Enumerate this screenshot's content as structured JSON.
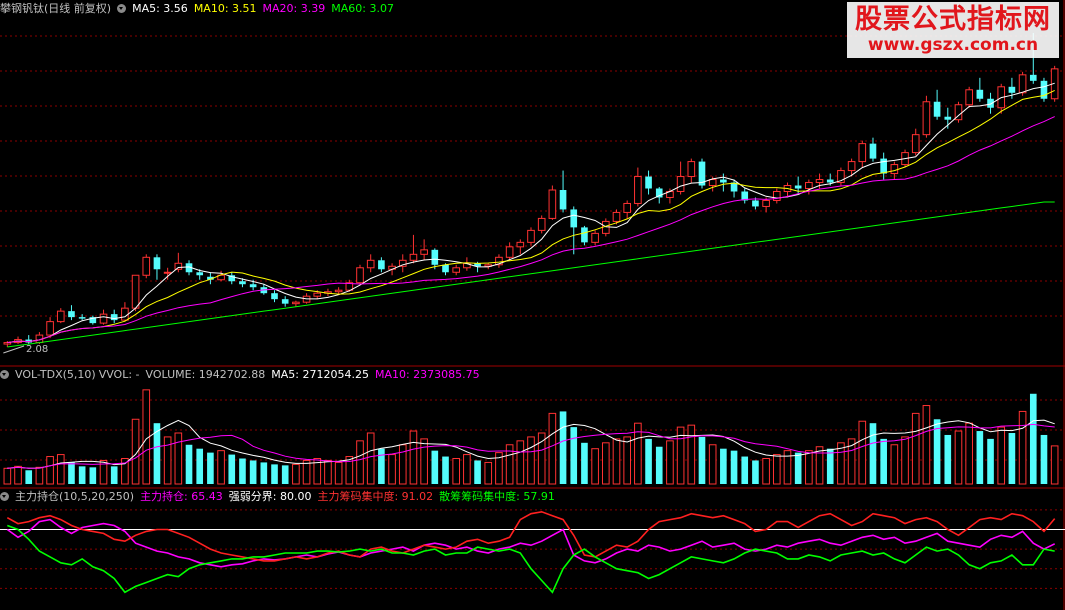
{
  "header_price": {
    "stock_name": "攀钢钒钛(日线 前复权)",
    "ma5": "MA5: 3.56",
    "ma10": "MA10: 3.51",
    "ma20": "MA20: 3.39",
    "ma60": "MA60: 3.07"
  },
  "header_volume": {
    "indicator": "VOL-TDX(5,10)",
    "vvol": "VVOL: -",
    "volume": "VOLUME: 1942702.88",
    "ma5": "MA5: 2712054.25",
    "ma10": "MA10: 2373085.75"
  },
  "header_zl": {
    "indicator": "主力持仓(10,5,20,250)",
    "holding": "主力持仓: 65.43",
    "boundary": "强弱分界: 80.00",
    "main_conc": "主力筹码集中度: 91.02",
    "retail_conc": "散筹筹码集中度: 57.91"
  },
  "low_label": "2.08",
  "watermark": {
    "title": "股票公式指标网",
    "url": "www.gszx.com.cn"
  },
  "colors": {
    "up": "#ff3232",
    "down": "#54fcfc",
    "ma5": "#ffffff",
    "ma10": "#ffff00",
    "ma20": "#ff00ff",
    "ma60": "#00ff00",
    "grid": "#8b0000",
    "frame": "#a00000"
  },
  "chart_data": [
    {
      "type": "candlestick",
      "title": "攀钢钒钛(日线 前复权)",
      "ylim": [
        2.0,
        4.3
      ],
      "low_marker": 2.08,
      "ohlc": [
        [
          2.12,
          2.14,
          2.1,
          2.13
        ],
        [
          2.13,
          2.17,
          2.12,
          2.15
        ],
        [
          2.15,
          2.18,
          2.12,
          2.13
        ],
        [
          2.13,
          2.2,
          2.12,
          2.18
        ],
        [
          2.18,
          2.3,
          2.16,
          2.27
        ],
        [
          2.27,
          2.36,
          2.26,
          2.34
        ],
        [
          2.34,
          2.38,
          2.28,
          2.3
        ],
        [
          2.3,
          2.32,
          2.28,
          2.29
        ],
        [
          2.3,
          2.31,
          2.25,
          2.26
        ],
        [
          2.26,
          2.35,
          2.25,
          2.32
        ],
        [
          2.32,
          2.35,
          2.26,
          2.28
        ],
        [
          2.28,
          2.4,
          2.27,
          2.36
        ],
        [
          2.36,
          2.58,
          2.34,
          2.58
        ],
        [
          2.58,
          2.72,
          2.56,
          2.7
        ],
        [
          2.7,
          2.72,
          2.55,
          2.62
        ],
        [
          2.6,
          2.63,
          2.55,
          2.6
        ],
        [
          2.62,
          2.73,
          2.6,
          2.66
        ],
        [
          2.66,
          2.68,
          2.58,
          2.6
        ],
        [
          2.6,
          2.62,
          2.55,
          2.58
        ],
        [
          2.57,
          2.6,
          2.52,
          2.55
        ],
        [
          2.55,
          2.61,
          2.54,
          2.58
        ],
        [
          2.58,
          2.6,
          2.52,
          2.54
        ],
        [
          2.54,
          2.56,
          2.5,
          2.52
        ],
        [
          2.52,
          2.55,
          2.48,
          2.5
        ],
        [
          2.5,
          2.52,
          2.45,
          2.46
        ],
        [
          2.46,
          2.48,
          2.4,
          2.42
        ],
        [
          2.42,
          2.44,
          2.37,
          2.39
        ],
        [
          2.39,
          2.41,
          2.37,
          2.4
        ],
        [
          2.4,
          2.46,
          2.39,
          2.44
        ],
        [
          2.44,
          2.48,
          2.42,
          2.46
        ],
        [
          2.46,
          2.49,
          2.44,
          2.47
        ],
        [
          2.47,
          2.5,
          2.45,
          2.48
        ],
        [
          2.48,
          2.55,
          2.47,
          2.53
        ],
        [
          2.53,
          2.65,
          2.52,
          2.63
        ],
        [
          2.63,
          2.72,
          2.6,
          2.68
        ],
        [
          2.68,
          2.7,
          2.6,
          2.62
        ],
        [
          2.62,
          2.66,
          2.58,
          2.64
        ],
        [
          2.64,
          2.72,
          2.6,
          2.68
        ],
        [
          2.68,
          2.85,
          2.66,
          2.72
        ],
        [
          2.72,
          2.82,
          2.68,
          2.75
        ],
        [
          2.75,
          2.76,
          2.62,
          2.65
        ],
        [
          2.65,
          2.66,
          2.58,
          2.6
        ],
        [
          2.6,
          2.65,
          2.58,
          2.63
        ],
        [
          2.63,
          2.7,
          2.61,
          2.66
        ],
        [
          2.66,
          2.67,
          2.6,
          2.64
        ],
        [
          2.64,
          2.66,
          2.62,
          2.65
        ],
        [
          2.65,
          2.72,
          2.63,
          2.7
        ],
        [
          2.7,
          2.8,
          2.68,
          2.77
        ],
        [
          2.77,
          2.82,
          2.72,
          2.8
        ],
        [
          2.8,
          2.9,
          2.78,
          2.88
        ],
        [
          2.88,
          2.98,
          2.86,
          2.96
        ],
        [
          2.96,
          3.18,
          2.95,
          3.15
        ],
        [
          3.15,
          3.28,
          3.0,
          3.02
        ],
        [
          3.02,
          3.04,
          2.72,
          2.9
        ],
        [
          2.9,
          2.91,
          2.78,
          2.8
        ],
        [
          2.8,
          2.88,
          2.78,
          2.86
        ],
        [
          2.86,
          2.96,
          2.84,
          2.94
        ],
        [
          2.94,
          3.02,
          2.92,
          3.0
        ],
        [
          3.0,
          3.08,
          2.96,
          3.06
        ],
        [
          3.06,
          3.3,
          3.04,
          3.24
        ],
        [
          3.24,
          3.28,
          3.12,
          3.16
        ],
        [
          3.16,
          3.17,
          3.06,
          3.1
        ],
        [
          3.1,
          3.16,
          3.06,
          3.14
        ],
        [
          3.14,
          3.34,
          3.12,
          3.24
        ],
        [
          3.24,
          3.36,
          3.2,
          3.34
        ],
        [
          3.34,
          3.36,
          3.16,
          3.18
        ],
        [
          3.18,
          3.24,
          3.14,
          3.22
        ],
        [
          3.22,
          3.26,
          3.14,
          3.2
        ],
        [
          3.2,
          3.22,
          3.1,
          3.14
        ],
        [
          3.14,
          3.16,
          3.06,
          3.08
        ],
        [
          3.08,
          3.1,
          3.02,
          3.04
        ],
        [
          3.04,
          3.1,
          3.0,
          3.08
        ],
        [
          3.08,
          3.16,
          3.06,
          3.14
        ],
        [
          3.14,
          3.2,
          3.1,
          3.18
        ],
        [
          3.18,
          3.24,
          3.12,
          3.16
        ],
        [
          3.16,
          3.22,
          3.12,
          3.2
        ],
        [
          3.2,
          3.26,
          3.16,
          3.22
        ],
        [
          3.22,
          3.26,
          3.18,
          3.2
        ],
        [
          3.2,
          3.3,
          3.18,
          3.28
        ],
        [
          3.28,
          3.36,
          3.24,
          3.34
        ],
        [
          3.34,
          3.48,
          3.3,
          3.46
        ],
        [
          3.46,
          3.5,
          3.34,
          3.36
        ],
        [
          3.36,
          3.4,
          3.22,
          3.26
        ],
        [
          3.26,
          3.34,
          3.22,
          3.32
        ],
        [
          3.32,
          3.42,
          3.3,
          3.4
        ],
        [
          3.4,
          3.56,
          3.38,
          3.52
        ],
        [
          3.52,
          3.78,
          3.5,
          3.74
        ],
        [
          3.74,
          3.82,
          3.62,
          3.64
        ],
        [
          3.64,
          3.7,
          3.56,
          3.62
        ],
        [
          3.62,
          3.74,
          3.6,
          3.72
        ],
        [
          3.72,
          3.84,
          3.7,
          3.82
        ],
        [
          3.82,
          3.9,
          3.74,
          3.76
        ],
        [
          3.76,
          3.8,
          3.66,
          3.7
        ],
        [
          3.7,
          3.86,
          3.66,
          3.84
        ],
        [
          3.84,
          3.9,
          3.76,
          3.8
        ],
        [
          3.8,
          3.94,
          3.78,
          3.92
        ],
        [
          3.92,
          4.2,
          3.86,
          3.88
        ],
        [
          3.88,
          3.9,
          3.74,
          3.76
        ],
        [
          3.76,
          3.98,
          3.74,
          3.96
        ]
      ],
      "ma60": [
        2.1,
        2.11,
        2.12,
        2.13,
        2.14,
        2.15,
        2.16,
        2.17,
        2.18,
        2.19,
        2.2,
        2.21,
        2.22,
        2.23,
        2.24,
        2.25,
        2.26,
        2.27,
        2.28,
        2.29,
        2.3,
        2.31,
        2.32,
        2.33,
        2.34,
        2.35,
        2.36,
        2.37,
        2.38,
        2.39,
        2.4,
        2.41,
        2.42,
        2.43,
        2.44,
        2.45,
        2.46,
        2.47,
        2.48,
        2.49,
        2.5,
        2.51,
        2.52,
        2.53,
        2.54,
        2.55,
        2.56,
        2.57,
        2.58,
        2.59,
        2.6,
        2.61,
        2.62,
        2.63,
        2.64,
        2.65,
        2.66,
        2.67,
        2.68,
        2.69,
        2.7,
        2.71,
        2.72,
        2.73,
        2.74,
        2.75,
        2.76,
        2.77,
        2.78,
        2.79,
        2.8,
        2.81,
        2.82,
        2.83,
        2.84,
        2.85,
        2.86,
        2.87,
        2.88,
        2.89,
        2.9,
        2.91,
        2.92,
        2.93,
        2.94,
        2.95,
        2.96,
        2.97,
        2.98,
        2.99,
        3.0,
        3.01,
        3.02,
        3.03,
        3.04,
        3.05,
        3.06,
        3.07,
        3.07
      ]
    },
    {
      "type": "bar",
      "title": "VOL-TDX(5,10)",
      "ylim": [
        0,
        5200000
      ],
      "volume": [
        800000,
        900000,
        700000,
        850000,
        1400000,
        1500000,
        1100000,
        900000,
        850000,
        1200000,
        900000,
        1300000,
        3300000,
        4800000,
        3100000,
        2400000,
        2600000,
        2000000,
        1800000,
        1600000,
        1700000,
        1500000,
        1300000,
        1200000,
        1100000,
        1000000,
        950000,
        1000000,
        1200000,
        1300000,
        1200000,
        1100000,
        1400000,
        2200000,
        2600000,
        1800000,
        1500000,
        2000000,
        2700000,
        2300000,
        1700000,
        1400000,
        1300000,
        1500000,
        1200000,
        1100000,
        1600000,
        2000000,
        2200000,
        2400000,
        2600000,
        3600000,
        3700000,
        2900000,
        2100000,
        1800000,
        2100000,
        2300000,
        2400000,
        3100000,
        2300000,
        1900000,
        2200000,
        2900000,
        3000000,
        2400000,
        2000000,
        1800000,
        1700000,
        1400000,
        1200000,
        1300000,
        1500000,
        1700000,
        1600000,
        1700000,
        1900000,
        1800000,
        2100000,
        2300000,
        3200000,
        3100000,
        2300000,
        2000000,
        2400000,
        3600000,
        4000000,
        3300000,
        2500000,
        2700000,
        3100000,
        2700000,
        2300000,
        2900000,
        2600000,
        3700000,
        4600000,
        2500000,
        1942702.88
      ],
      "ma5_last": 2712054.25,
      "ma10_last": 2373085.75
    },
    {
      "type": "line",
      "title": "主力持仓(10,5,20,250)",
      "ylim": [
        0,
        110
      ],
      "boundary": 80,
      "series": [
        {
          "name": "主力持仓",
          "values": [
            80,
            72,
            78,
            88,
            90,
            82,
            76,
            82,
            84,
            86,
            84,
            78,
            66,
            62,
            58,
            56,
            52,
            50,
            46,
            44,
            42,
            44,
            45,
            48,
            50,
            49,
            50,
            52,
            54,
            52,
            55,
            57,
            54,
            52,
            56,
            58,
            60,
            62,
            58,
            64,
            66,
            64,
            60,
            62,
            58,
            56,
            60,
            62,
            66,
            64,
            68,
            74,
            80,
            54,
            48,
            46,
            50,
            56,
            60,
            58,
            64,
            62,
            58,
            60,
            64,
            68,
            62,
            64,
            66,
            60,
            58,
            60,
            64,
            62,
            66,
            68,
            70,
            66,
            64,
            68,
            72,
            74,
            70,
            72,
            66,
            68,
            72,
            76,
            68,
            66,
            64,
            62,
            70,
            74,
            72,
            78,
            66,
            60,
            65.43
          ]
        },
        {
          "name": "主力筹码集中度",
          "values": [
            92,
            86,
            88,
            92,
            94,
            90,
            84,
            80,
            78,
            76,
            70,
            68,
            74,
            78,
            80,
            80,
            76,
            72,
            66,
            60,
            56,
            54,
            52,
            50,
            48,
            48,
            50,
            52,
            50,
            52,
            56,
            58,
            54,
            52,
            60,
            62,
            58,
            56,
            60,
            64,
            62,
            60,
            62,
            68,
            70,
            66,
            68,
            72,
            90,
            96,
            98,
            94,
            90,
            74,
            54,
            52,
            58,
            64,
            62,
            68,
            80,
            88,
            90,
            92,
            96,
            94,
            92,
            94,
            90,
            86,
            78,
            80,
            88,
            88,
            82,
            88,
            94,
            96,
            90,
            84,
            88,
            96,
            94,
            92,
            86,
            90,
            92,
            88,
            80,
            74,
            82,
            90,
            92,
            90,
            96,
            94,
            88,
            78,
            91.02
          ]
        },
        {
          "name": "散筹筹码集中度",
          "values": [
            84,
            80,
            70,
            58,
            52,
            46,
            44,
            50,
            42,
            38,
            30,
            16,
            22,
            26,
            30,
            34,
            32,
            40,
            44,
            46,
            48,
            50,
            50,
            52,
            52,
            54,
            56,
            56,
            56,
            58,
            58,
            57,
            58,
            60,
            58,
            60,
            56,
            56,
            54,
            58,
            60,
            54,
            56,
            56,
            62,
            60,
            58,
            60,
            56,
            40,
            28,
            16,
            40,
            54,
            60,
            52,
            46,
            40,
            38,
            36,
            30,
            34,
            40,
            46,
            52,
            50,
            48,
            46,
            50,
            56,
            60,
            58,
            56,
            50,
            50,
            54,
            52,
            48,
            54,
            56,
            58,
            54,
            56,
            50,
            46,
            54,
            62,
            58,
            60,
            54,
            44,
            40,
            46,
            48,
            54,
            44,
            44,
            60,
            57.91
          ]
        }
      ]
    }
  ]
}
